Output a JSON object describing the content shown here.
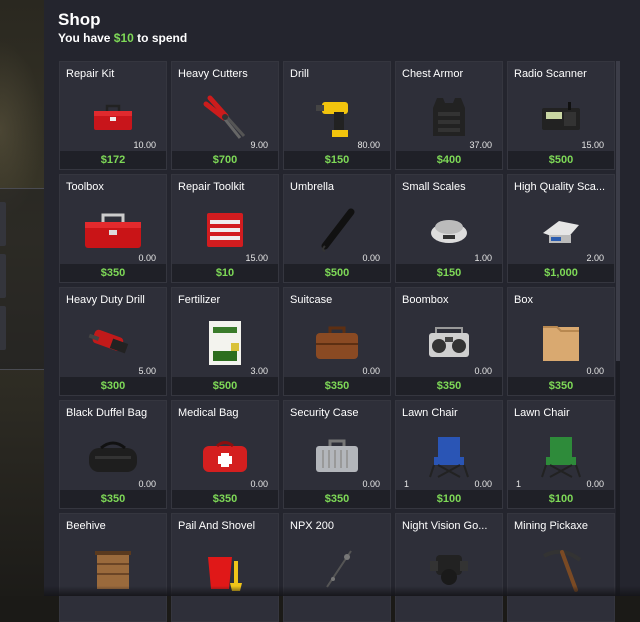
{
  "shop": {
    "title": "Shop",
    "subtitle_prefix": "You have ",
    "balance": "$10",
    "subtitle_suffix": " to spend",
    "items": [
      {
        "name": "Repair Kit",
        "icon": "toolbox-red-icon",
        "weight": "10.00",
        "price": "$172"
      },
      {
        "name": "Heavy Cutters",
        "icon": "bolt-cutters-icon",
        "weight": "9.00",
        "price": "$700"
      },
      {
        "name": "Drill",
        "icon": "drill-yellow-icon",
        "weight": "80.00",
        "price": "$150"
      },
      {
        "name": "Chest Armor",
        "icon": "chest-armor-icon",
        "weight": "37.00",
        "price": "$400"
      },
      {
        "name": "Radio Scanner",
        "icon": "radio-scanner-icon",
        "weight": "15.00",
        "price": "$500"
      },
      {
        "name": "Toolbox",
        "icon": "toolbox-icon",
        "weight": "0.00",
        "price": "$350"
      },
      {
        "name": "Repair Toolkit",
        "icon": "tool-chest-icon",
        "weight": "15.00",
        "price": "$10"
      },
      {
        "name": "Umbrella",
        "icon": "umbrella-icon",
        "weight": "0.00",
        "price": "$500"
      },
      {
        "name": "Small Scales",
        "icon": "small-scale-icon",
        "weight": "1.00",
        "price": "$150"
      },
      {
        "name": "High Quality Sca...",
        "icon": "digital-scale-icon",
        "weight": "2.00",
        "price": "$1,000"
      },
      {
        "name": "Heavy Duty Drill",
        "icon": "heavy-drill-icon",
        "weight": "5.00",
        "price": "$300"
      },
      {
        "name": "Fertilizer",
        "icon": "fertilizer-bag-icon",
        "weight": "3.00",
        "price": "$500"
      },
      {
        "name": "Suitcase",
        "icon": "suitcase-icon",
        "weight": "0.00",
        "price": "$350"
      },
      {
        "name": "Boombox",
        "icon": "boombox-icon",
        "weight": "0.00",
        "price": "$350"
      },
      {
        "name": "Box",
        "icon": "cardboard-box-icon",
        "weight": "0.00",
        "price": "$350"
      },
      {
        "name": "Black Duffel Bag",
        "icon": "duffel-bag-black-icon",
        "weight": "0.00",
        "price": "$350"
      },
      {
        "name": "Medical Bag",
        "icon": "medical-bag-icon",
        "weight": "0.00",
        "price": "$350"
      },
      {
        "name": "Security Case",
        "icon": "security-case-icon",
        "weight": "0.00",
        "price": "$350"
      },
      {
        "name": "Lawn Chair",
        "icon": "lawn-chair-blue-icon",
        "count": "1",
        "weight": "0.00",
        "price": "$100"
      },
      {
        "name": "Lawn Chair",
        "icon": "lawn-chair-green-icon",
        "count": "1",
        "weight": "0.00",
        "price": "$100"
      },
      {
        "name": "Beehive",
        "icon": "beehive-icon",
        "weight": "",
        "price": ""
      },
      {
        "name": "Pail And Shovel",
        "icon": "pail-shovel-icon",
        "weight": "",
        "price": ""
      },
      {
        "name": "NPX 200",
        "icon": "npx-200-icon",
        "weight": "",
        "price": ""
      },
      {
        "name": "Night Vision Go...",
        "icon": "night-vision-goggles-icon",
        "weight": "",
        "price": ""
      },
      {
        "name": "Mining Pickaxe",
        "icon": "pickaxe-icon",
        "weight": "",
        "price": ""
      }
    ]
  },
  "colors": {
    "panel_bg": "#24252e",
    "card_bg": "#2e2f39",
    "price_green": "#7ed957",
    "price_bar_bg": "#1f2027"
  }
}
